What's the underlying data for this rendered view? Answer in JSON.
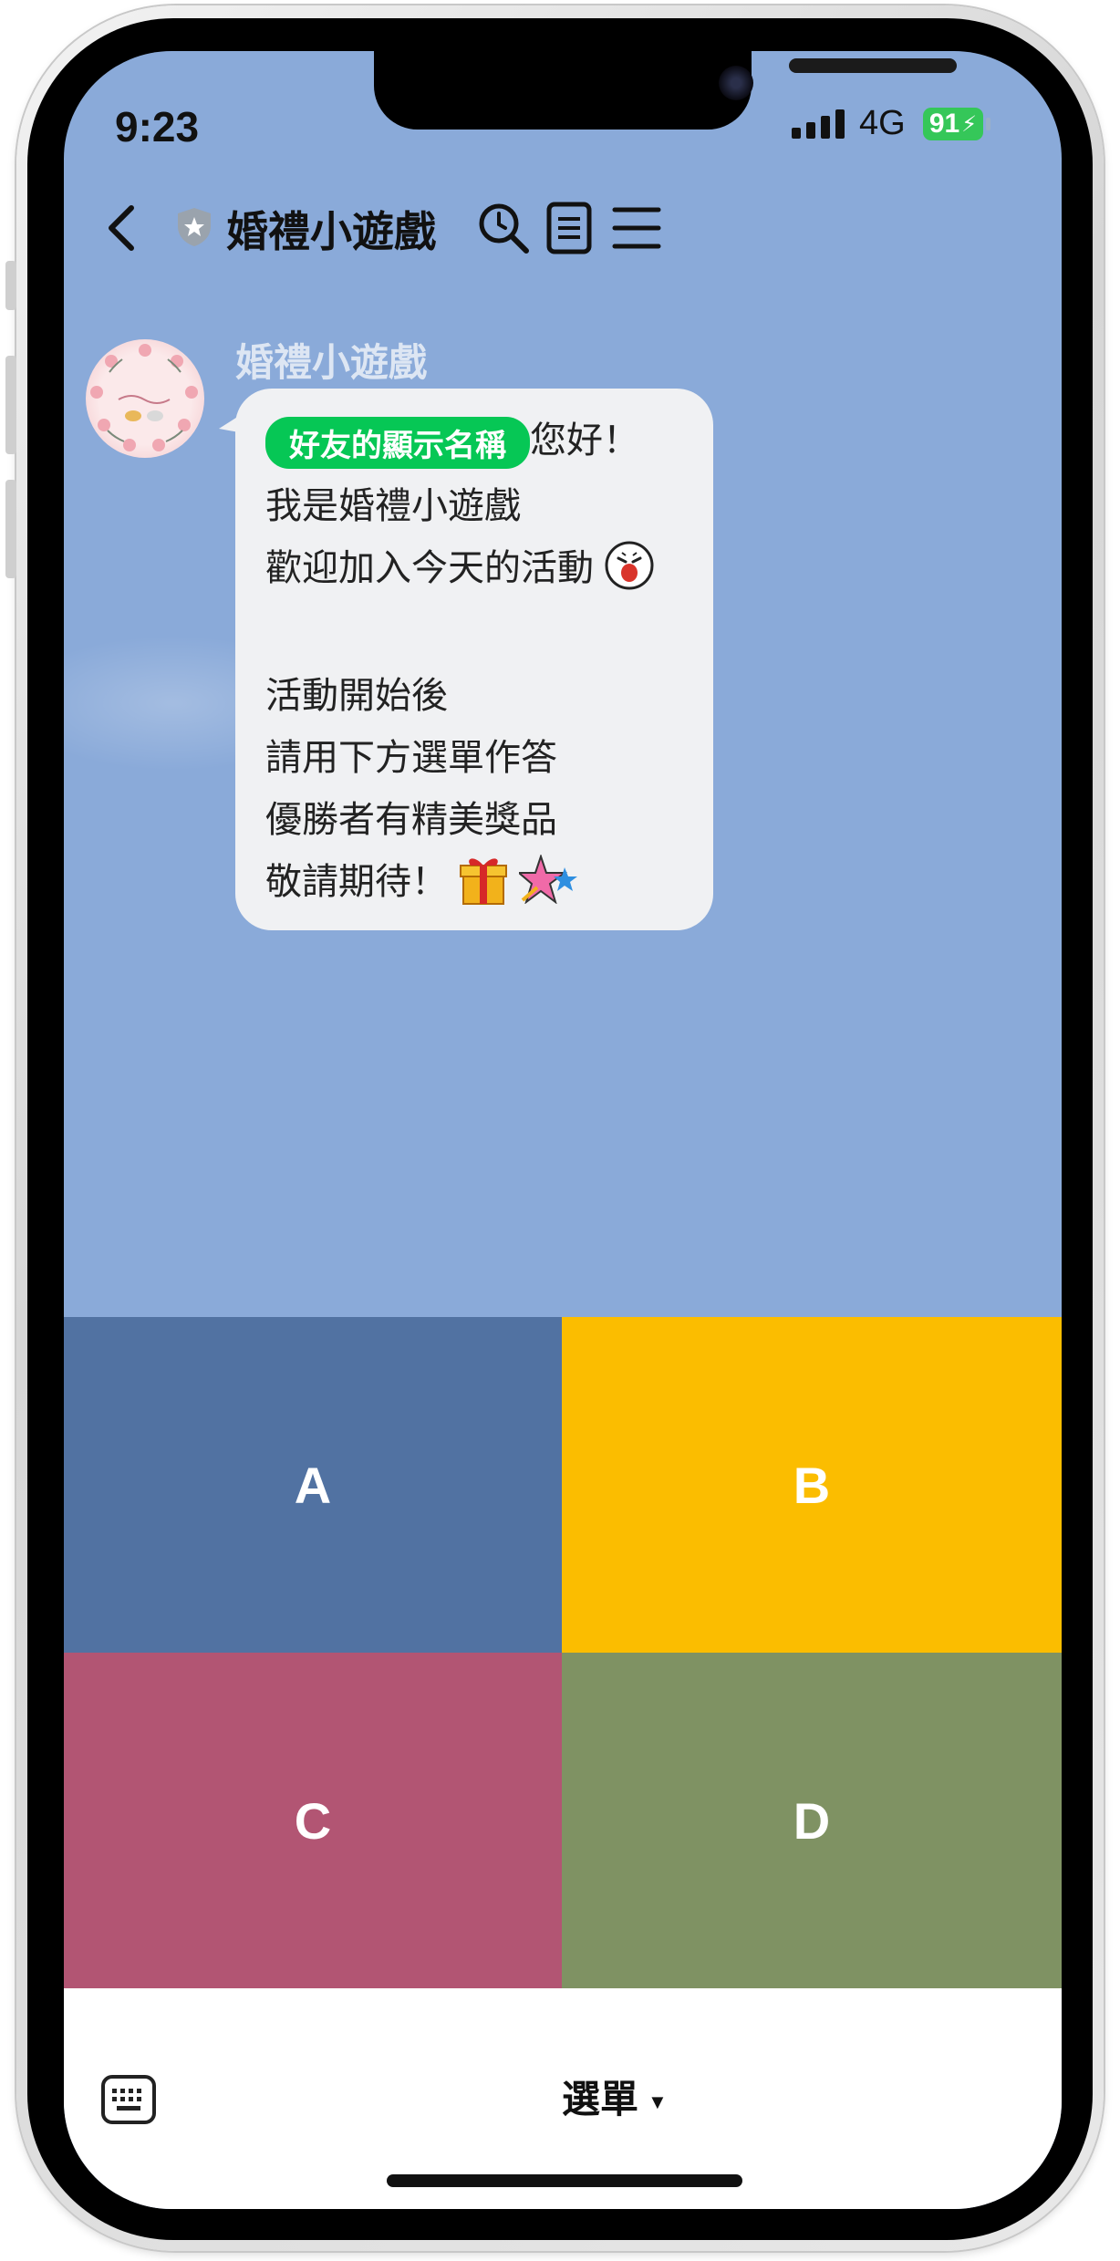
{
  "status_bar": {
    "time": "9:23",
    "network": "4G",
    "battery": "91"
  },
  "header": {
    "title": "婚禮小遊戲",
    "back_icon": "chevron-left-icon",
    "verified_icon": "shield-icon",
    "search_icon": "search-icon",
    "notes_icon": "notes-icon",
    "menu_icon": "hamburger-menu-icon"
  },
  "chat": {
    "sender": "婚禮小遊戲",
    "message": {
      "mention_tag": "好友的顯示名稱",
      "greeting": "您好！",
      "lines": [
        "我是婚禮小遊戲",
        "歡迎加入今天的活動",
        "活動開始後",
        "請用下方選單作答",
        "優勝者有精美獎品",
        "敬請期待！"
      ]
    }
  },
  "rich_menu": {
    "options": [
      {
        "label": "A",
        "color": "#5172a2"
      },
      {
        "label": "B",
        "color": "#fbbd00"
      },
      {
        "label": "C",
        "color": "#b25573"
      },
      {
        "label": "D",
        "color": "#7f9263"
      }
    ]
  },
  "bottom_bar": {
    "menu_label": "選單",
    "keyboard_icon": "keyboard-icon"
  },
  "colors": {
    "chat_background": "#8aaad9",
    "bubble": "#f0f1f3",
    "mention_tag": "#06c755"
  }
}
